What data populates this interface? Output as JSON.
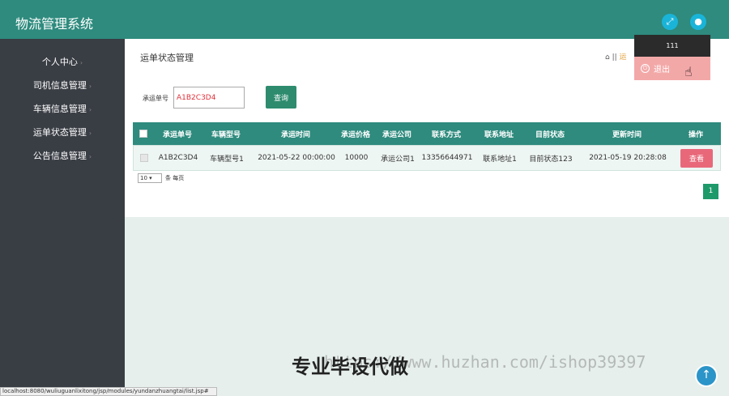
{
  "header": {
    "title": "物流管理系统",
    "fullscreen_icon": "expand-icon",
    "user_icon": "user-icon"
  },
  "user_menu": {
    "username": "111",
    "logout_label": "退出"
  },
  "sidebar": {
    "items": [
      {
        "label": "个人中心"
      },
      {
        "label": "司机信息管理"
      },
      {
        "label": "车辆信息管理"
      },
      {
        "label": "运单状态管理"
      },
      {
        "label": "公告信息管理"
      }
    ]
  },
  "page": {
    "title": "运单状态管理",
    "breadcrumb": "运"
  },
  "search": {
    "label": "承运单号",
    "value": "A1B2C3D4",
    "button": "查询"
  },
  "table": {
    "headers": [
      "承运单号",
      "车辆型号",
      "承运时间",
      "承运价格",
      "承运公司",
      "联系方式",
      "联系地址",
      "目前状态",
      "更新时间",
      "操作"
    ],
    "rows": [
      {
        "cells": [
          "A1B2C3D4",
          "车辆型号1",
          "2021-05-22 00:00:00",
          "10000",
          "承运公司1",
          "13356644971",
          "联系地址1",
          "目前状态123",
          "2021-05-19 20:28:08"
        ],
        "action": "查看"
      }
    ]
  },
  "pagination": {
    "page_size": "10",
    "page_size_label": "条 每页",
    "current_page": "1"
  },
  "statusbar": {
    "url": "localhost:8080/wuliuguanlixitong/jsp/modules/yundanzhuangtai/list.jsp#"
  },
  "watermark": {
    "text": "专业毕设代做",
    "url": "https://www.huzhan.com/ishop39397"
  },
  "colors": {
    "primary": "#2e8b7e",
    "sidebar": "#393d44",
    "danger": "#e8687a"
  }
}
